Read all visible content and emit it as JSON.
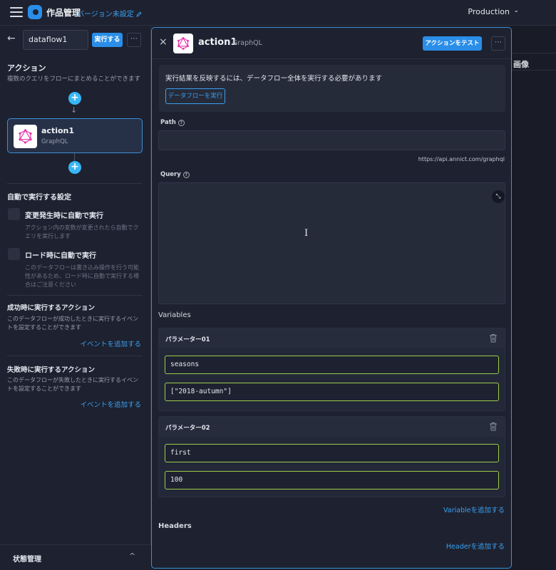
{
  "topbar": {
    "title": "作品管理",
    "version_link": "バージョン未設定",
    "environment": "Production",
    "environment_chevron": "⌄"
  },
  "left": {
    "back_icon": "←",
    "flow_name": "dataflow1",
    "run_label": "実行する",
    "more_label": "⋯",
    "actions_heading": "アクション",
    "actions_desc": "複数のクエリをフローにまとめることができます",
    "action_card": {
      "name": "action1",
      "type": "GraphQL"
    },
    "autorun_heading": "自動で実行する設定",
    "autorun_options": [
      {
        "label": "変更発生時に自動で実行",
        "desc": "アクション内の変数が変更されたら自動でクエリを実行します"
      },
      {
        "label": "ロード時に自動で実行",
        "desc": "このデータフローは書き込み操作を行う可能性があるため、ロード時に自動で実行する場合はご注意ください"
      }
    ],
    "success_heading": "成功時に実行するアクション",
    "success_desc": "このデータフローが成功したときに実行するイベントを設定することができます",
    "success_add": "イベントを追加する",
    "failure_heading": "失敗時に実行するアクション",
    "failure_desc": "このデータフローが失敗したときに実行するイベントを設定することができます",
    "failure_add": "イベントを追加する",
    "state_label": "状態管理",
    "state_chevron": "^"
  },
  "background": {
    "image_column": "画像"
  },
  "panel": {
    "close_icon": "×",
    "title": "action1",
    "subtitle": "GraphQL",
    "test_label": "アクションをテスト",
    "more_label": "⋯",
    "notice_text": "実行結果を反映するには、データフロー全体を実行する必要があります",
    "run_flow_label": "データフローを実行",
    "path_label": "Path",
    "path_value": "",
    "base_url": "https://api.annict.com/graphql",
    "query_label": "Query",
    "query_value": "",
    "variables_label": "Variables",
    "params": [
      {
        "name": "パラメーター01",
        "key": "seasons",
        "value": "[\"2018-autumn\"]"
      },
      {
        "name": "パラメーター02",
        "key": "first",
        "value": "100"
      }
    ],
    "add_variable": "Variableを追加する",
    "headers_label": "Headers",
    "add_header": "Headerを追加する"
  },
  "colors": {
    "accent": "#2a8ee8",
    "link": "#3aa0f0",
    "input_border_valid": "#9ccc4a",
    "graphql_pink": "#e535ab"
  },
  "icons": {
    "menu": "hamburger-icon",
    "logo": "app-logo-icon",
    "edit": "pencil-icon",
    "graphql": "graphql-icon",
    "trash": "trash-icon",
    "expand": "expand-icon",
    "help": "help-icon"
  }
}
